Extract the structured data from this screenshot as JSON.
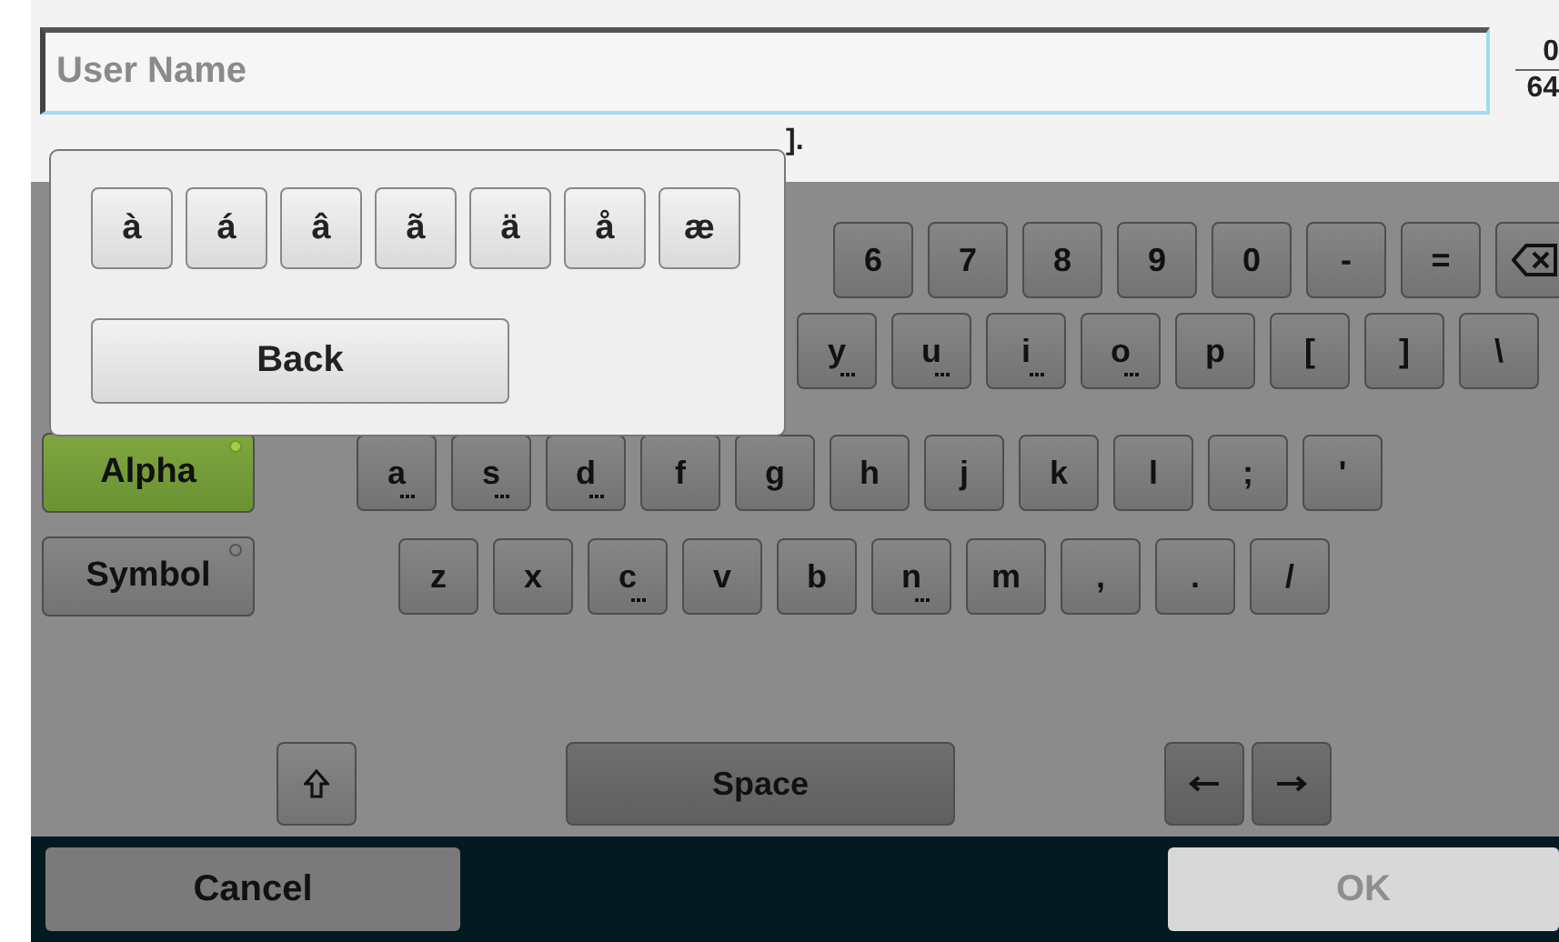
{
  "field": {
    "placeholder": "User Name",
    "count": "0",
    "max": "64"
  },
  "hint": "].",
  "keyboard": {
    "rows": [
      {
        "mode": null,
        "keys": [
          {
            "label": "6"
          },
          {
            "label": "7"
          },
          {
            "label": "8"
          },
          {
            "label": "9"
          },
          {
            "label": "0"
          },
          {
            "label": "-"
          },
          {
            "label": "="
          }
        ]
      },
      {
        "mode": null,
        "keys": [
          {
            "label": "y",
            "more": true
          },
          {
            "label": "u",
            "more": true
          },
          {
            "label": "i",
            "more": true
          },
          {
            "label": "o",
            "more": true
          },
          {
            "label": "p"
          },
          {
            "label": "["
          },
          {
            "label": "]"
          },
          {
            "label": "\\"
          }
        ]
      },
      {
        "mode": {
          "label": "Alpha",
          "selected": true
        },
        "keys": [
          {
            "label": "a",
            "more": true
          },
          {
            "label": "s",
            "more": true
          },
          {
            "label": "d",
            "more": true
          },
          {
            "label": "f"
          },
          {
            "label": "g"
          },
          {
            "label": "h"
          },
          {
            "label": "j"
          },
          {
            "label": "k"
          },
          {
            "label": "l"
          },
          {
            "label": ";"
          },
          {
            "label": "'"
          }
        ]
      },
      {
        "mode": {
          "label": "Symbol",
          "selected": false
        },
        "keys": [
          {
            "label": "z"
          },
          {
            "label": "x"
          },
          {
            "label": "c",
            "more": true
          },
          {
            "label": "v"
          },
          {
            "label": "b"
          },
          {
            "label": "n",
            "more": true
          },
          {
            "label": "m"
          },
          {
            "label": ","
          },
          {
            "label": "."
          },
          {
            "label": "/"
          }
        ]
      }
    ],
    "space": "Space"
  },
  "popup": {
    "accents": [
      "à",
      "á",
      "â",
      "ã",
      "ä",
      "å",
      "æ"
    ],
    "back": "Back"
  },
  "footer": {
    "cancel": {
      "label": "Cancel",
      "disabled": false
    },
    "ok": {
      "label": "OK",
      "disabled": true
    }
  }
}
